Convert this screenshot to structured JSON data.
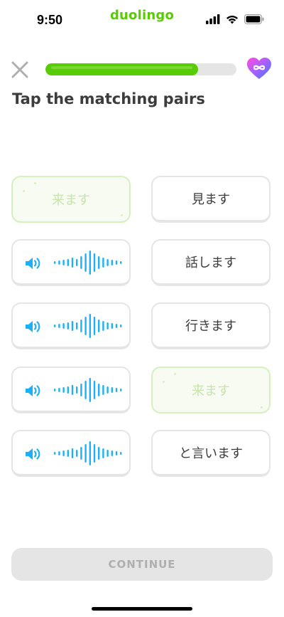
{
  "status_bar": {
    "time": "9:50",
    "app_name": "duolingo",
    "icons": [
      "cellular-signal-icon",
      "wifi-icon",
      "battery-icon"
    ]
  },
  "header": {
    "close_icon": "close-icon",
    "progress": 0.8,
    "hearts_icon": "infinity-heart-icon"
  },
  "prompt": {
    "title": "Tap the matching pairs"
  },
  "left_column": [
    {
      "type": "text",
      "text": "来ます",
      "state": "matched"
    },
    {
      "type": "audio",
      "icon": "speaker-icon",
      "state": "default"
    },
    {
      "type": "audio",
      "icon": "speaker-icon",
      "state": "default"
    },
    {
      "type": "audio",
      "icon": "speaker-icon",
      "state": "default"
    },
    {
      "type": "audio",
      "icon": "speaker-icon",
      "state": "default"
    }
  ],
  "right_column": [
    {
      "type": "text",
      "text": "見ます",
      "state": "default"
    },
    {
      "type": "text",
      "text": "話します",
      "state": "default"
    },
    {
      "type": "text",
      "text": "行きます",
      "state": "default"
    },
    {
      "type": "text",
      "text": "来ます",
      "state": "matched"
    },
    {
      "type": "text",
      "text": "と言います",
      "state": "default"
    }
  ],
  "footer": {
    "continue_label": "CONTINUE"
  },
  "colors": {
    "brand_green": "#58cc02",
    "audio_blue": "#1cb0f6",
    "matched_bg": "#f7fbf1",
    "matched_border": "#d7f0bf",
    "disabled_button": "#e5e5e5"
  }
}
